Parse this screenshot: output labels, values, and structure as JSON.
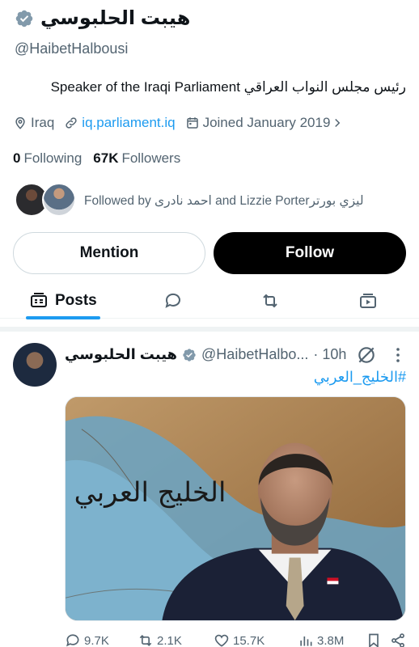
{
  "profile": {
    "name": "هيبت الحلبوسي",
    "handle": "@HaibetHalbousi",
    "bio": "رئيس مجلس النواب العراقي Speaker of the Iraqi Parliament",
    "location": "Iraq",
    "website": "iq.parliament.iq",
    "joined": "Joined January 2019",
    "following_count": "0",
    "following_label": "Following",
    "followers_count": "67K",
    "followers_label": "Followers",
    "followed_by": "Followed by احمد نادرى and Lizzie Porterليزي بورتر"
  },
  "buttons": {
    "mention": "Mention",
    "follow": "Follow"
  },
  "tabs": {
    "posts": "Posts"
  },
  "post": {
    "name": "هيبت الحلبوسي",
    "handle": "@HaibetHalbo...",
    "time": "· 10h",
    "hashtag": "#الخليج_العربي",
    "image_caption": "الخليج العربي",
    "stats": {
      "replies": "9.7K",
      "reposts": "2.1K",
      "likes": "15.7K",
      "views": "3.8M"
    }
  },
  "colors": {
    "accent": "#1d9bf0",
    "text": "#0f1419",
    "muted": "#536471",
    "verified": "#829aab"
  },
  "icons": [
    "verified-badge-icon",
    "location-icon",
    "link-icon",
    "calendar-icon",
    "chevron-right-icon",
    "posts-tab-icon",
    "replies-tab-icon",
    "reposts-tab-icon",
    "media-tab-icon",
    "grok-icon",
    "more-icon",
    "reply-icon",
    "repost-icon",
    "like-icon",
    "views-icon",
    "bookmark-icon",
    "share-icon"
  ]
}
